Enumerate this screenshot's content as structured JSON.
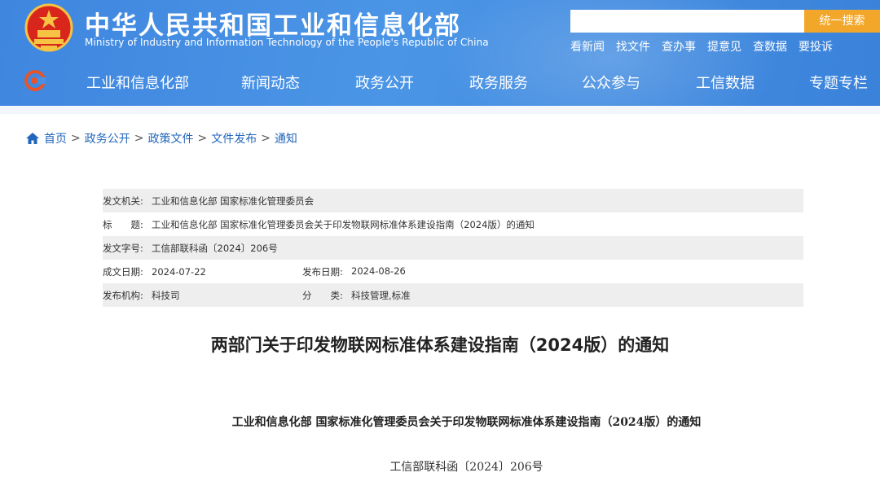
{
  "header": {
    "site_title": "中华人民共和国工业和信息化部",
    "site_subtitle": "Ministry of Industry and Information Technology of the People's Republic of China",
    "search": {
      "placeholder": "",
      "button_label": "统一搜索"
    },
    "quick_links": [
      "看新闻",
      "找文件",
      "查办事",
      "提意见",
      "查数据",
      "要投诉"
    ]
  },
  "nav": {
    "items": [
      "工业和信息化部",
      "新闻动态",
      "政务公开",
      "政务服务",
      "公众参与",
      "工信数据",
      "专题专栏"
    ]
  },
  "breadcrumb": [
    "首页",
    "政务公开",
    "政策文件",
    "文件发布",
    "通知"
  ],
  "meta": {
    "issuer_label": "发文机关:",
    "issuer": "工业和信息化部 国家标准化管理委员会",
    "title_label": "标　　题:",
    "title": "工业和信息化部 国家标准化管理委员会关于印发物联网标准体系建设指南（2024版）的通知",
    "doc_no_label": "发文字号:",
    "doc_no": "工信部联科函〔2024〕206号",
    "written_label": "成文日期:",
    "written": "2024-07-22",
    "published_label": "发布日期:",
    "published": "2024-08-26",
    "org_label": "发布机构:",
    "org": "科技司",
    "category_label": "分　　类:",
    "category": "科技管理,标准"
  },
  "article": {
    "title": "两部门关于印发物联网标准体系建设指南（2024版）的通知",
    "heading": "工业和信息化部 国家标准化管理委员会关于印发物联网标准体系建设指南（2024版）的通知",
    "doc_number": "工信部联科函〔2024〕206号"
  },
  "colors": {
    "header_blue": "#4a90e2",
    "search_orange": "#f2a72a",
    "link_blue": "#2266bb",
    "meta_shade": "#eeeeee"
  }
}
